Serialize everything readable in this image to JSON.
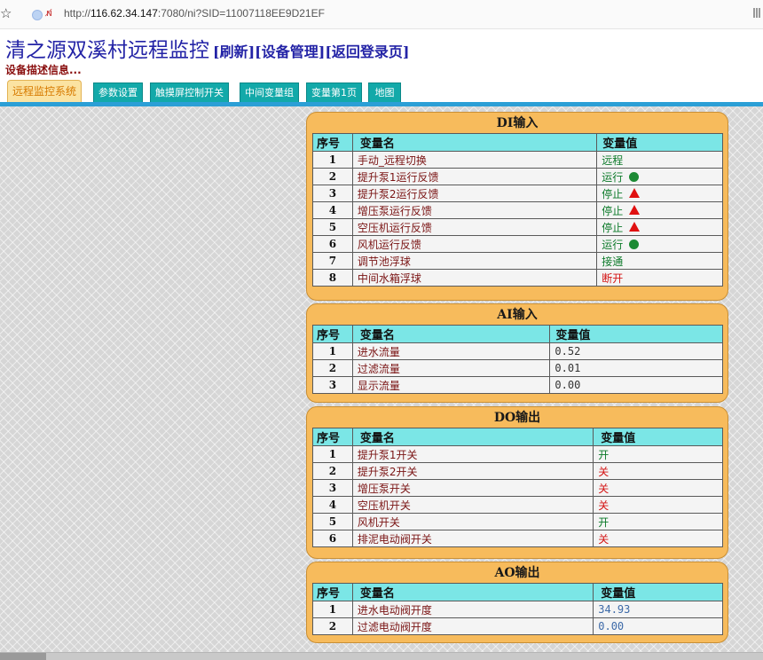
{
  "browser": {
    "url_prefix": "http://",
    "url_host": "116.62.34.147",
    "url_rest": ":7080/ni?SID=11007118EE9D21EF"
  },
  "header": {
    "title": "清之源双溪村远程监控",
    "links": [
      "[刷新]",
      "[设备管理]",
      "[返回登录页]"
    ],
    "description": "设备描述信息..."
  },
  "tabs": [
    {
      "label": "远程监控系统",
      "active": true
    },
    {
      "label": "参数设置",
      "active": false
    },
    {
      "label": "触摸屏控制开关",
      "active": false
    },
    {
      "label": "中间变量组",
      "active": false
    },
    {
      "label": "变量第1页",
      "active": false
    },
    {
      "label": "地图",
      "active": false
    }
  ],
  "columns": {
    "index": "序号",
    "name": "变量名",
    "value": "变量值"
  },
  "di": {
    "title": "DI输入",
    "rows": [
      {
        "no": "1",
        "name": "手动_远程切换",
        "value": "远程",
        "status": ""
      },
      {
        "no": "2",
        "name": "提升泵1运行反馈",
        "value": "运行",
        "status": "on"
      },
      {
        "no": "3",
        "name": "提升泵2运行反馈",
        "value": "停止",
        "status": "off"
      },
      {
        "no": "4",
        "name": "增压泵运行反馈",
        "value": "停止",
        "status": "off"
      },
      {
        "no": "5",
        "name": "空压机运行反馈",
        "value": "停止",
        "status": "off"
      },
      {
        "no": "6",
        "name": "风机运行反馈",
        "value": "运行",
        "status": "on"
      },
      {
        "no": "7",
        "name": "调节池浮球",
        "value": "接通",
        "status": ""
      },
      {
        "no": "8",
        "name": "中间水箱浮球",
        "value": "断开",
        "status": ""
      }
    ]
  },
  "ai": {
    "title": "AI输入",
    "rows": [
      {
        "no": "1",
        "name": "进水流量",
        "value": "0.52"
      },
      {
        "no": "2",
        "name": "过滤流量",
        "value": "0.01"
      },
      {
        "no": "3",
        "name": "显示流量",
        "value": "0.00"
      }
    ]
  },
  "do": {
    "title": "DO输出",
    "rows": [
      {
        "no": "1",
        "name": "提升泵1开关",
        "value": "开"
      },
      {
        "no": "2",
        "name": "提升泵2开关",
        "value": "关"
      },
      {
        "no": "3",
        "name": "增压泵开关",
        "value": "关"
      },
      {
        "no": "4",
        "name": "空压机开关",
        "value": "关"
      },
      {
        "no": "5",
        "name": "风机开关",
        "value": "开"
      },
      {
        "no": "6",
        "name": "排泥电动阀开关",
        "value": "关"
      }
    ]
  },
  "ao": {
    "title": "AO输出",
    "rows": [
      {
        "no": "1",
        "name": "进水电动阀开度",
        "value": "34.93"
      },
      {
        "no": "2",
        "name": "过滤电动阀开度",
        "value": "0.00"
      }
    ]
  },
  "colors": {
    "title": "#2323a6",
    "tab": "#13a9a9",
    "tab_active": "#fbe3a2",
    "panel": "#f7bb5c",
    "header_row": "#7be6e6",
    "running": "#1c8a34",
    "stopped": "#e01010"
  }
}
